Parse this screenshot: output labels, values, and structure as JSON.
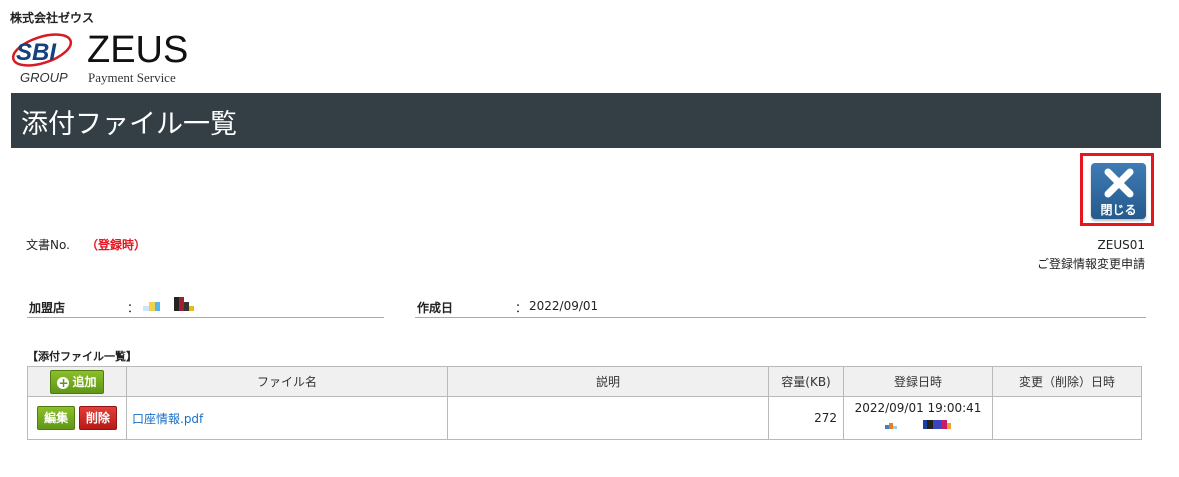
{
  "header": {
    "company": "株式会社ゼウス",
    "logo_sbi": "SBI",
    "logo_group": "GROUP",
    "logo_zeus": "ZEUS",
    "logo_tagline": "Payment Service"
  },
  "page": {
    "title": "添付ファイル一覧"
  },
  "close_button": {
    "label": "閉じる",
    "icon": "close-x-icon"
  },
  "document": {
    "no_label": "文書No.",
    "no_value": "（登録時）",
    "code": "ZEUS01",
    "form_name": "ご登録情報変更申請"
  },
  "fields": {
    "merchant_label": "加盟店",
    "merchant_colon": "：",
    "date_label": "作成日",
    "date_colon": "：",
    "date_value": "2022/09/01"
  },
  "attachments": {
    "section_title": "【添付ファイル一覧】",
    "add_label": "追加",
    "headers": [
      "ファイル名",
      "説明",
      "容量(KB)",
      "登録日時",
      "変更（削除）日時"
    ],
    "rows": [
      {
        "edit_label": "編集",
        "delete_label": "削除",
        "file_name": "口座情報.pdf",
        "description": "",
        "size": "272",
        "registered": "2022/09/01 19:00:41",
        "modified": ""
      }
    ]
  },
  "colors": {
    "title_bar": "#333f44",
    "close_highlight": "#e8141f",
    "close_button": "#2f6aa3",
    "add_button": "#6ea61f",
    "delete_button": "#cc2a24",
    "link": "#1a6fc7"
  }
}
